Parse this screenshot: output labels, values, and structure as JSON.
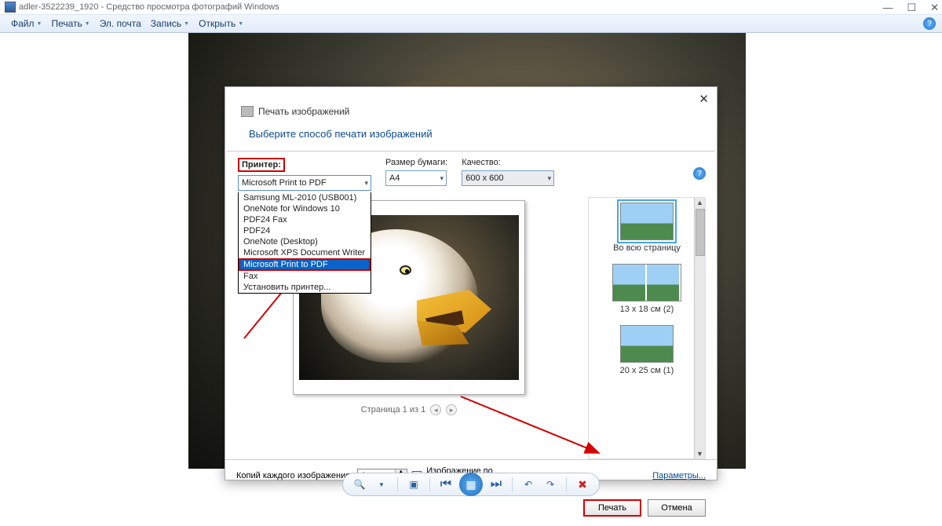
{
  "window": {
    "title": "adler-3522239_1920 - Средство просмотра фотографий Windows"
  },
  "menu": {
    "file": "Файл",
    "print": "Печать",
    "email": "Эл. почта",
    "burn": "Запись",
    "open": "Открыть"
  },
  "dialog": {
    "head": "Печать изображений",
    "title": "Выберите способ печати изображений",
    "printer_label": "Принтер:",
    "paper_label": "Размер бумаги:",
    "quality_label": "Качество:",
    "printer_value": "Microsoft Print to PDF",
    "paper_value": "A4",
    "quality_value": "600 x 600",
    "options": {
      "o0": "Samsung ML-2010 (USB001)",
      "o1": "OneNote for Windows 10",
      "o2": "PDF24 Fax",
      "o3": "PDF24",
      "o4": "OneNote (Desktop)",
      "o5": "Microsoft XPS Document Writer",
      "o6": "Microsoft Print to PDF",
      "o7": "Fax",
      "o8": "Установить принтер..."
    },
    "pager": "Страница 1 из 1",
    "layouts": {
      "l0": "Во всю страницу",
      "l1": "13 x 18 см (2)",
      "l2": "20 x 25 см (1)"
    },
    "copies_label": "Копий каждого изображения:",
    "copies_value": "1",
    "fit_label": "Изображение по размеру кадра",
    "params": "Параметры...",
    "print_btn": "Печать",
    "cancel_btn": "Отмена"
  }
}
